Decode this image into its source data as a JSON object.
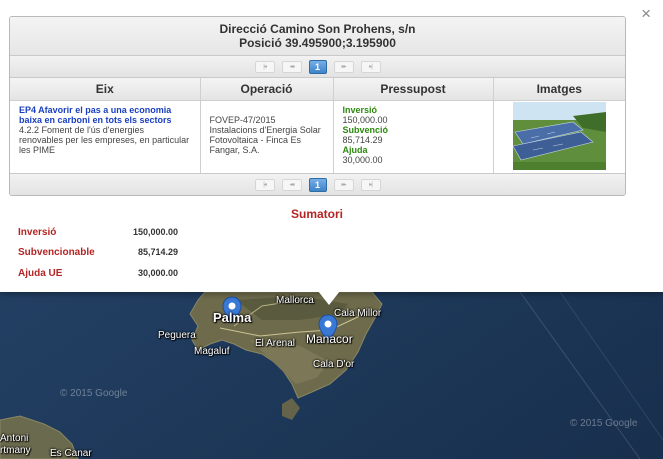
{
  "popup": {
    "close_symbol": "×",
    "header_line1": "Direcció Camino Son Prohens, s/n",
    "header_line2": "Posició 39.495900;3.195900",
    "pager": {
      "first": "|◂",
      "prev": "◂◂",
      "page": "1",
      "next": "▸▸",
      "last": "▸|"
    },
    "columns": [
      "Eix",
      "Operació",
      "Pressupost",
      "Imatges"
    ],
    "row": {
      "eix_title": "EP4 Afavorir el pas a una economia baixa en carboni en tots els sectors",
      "eix_desc": "4.2.2 Foment de l'ús d'energies renovables per les empreses, en particular les PIME",
      "operacio": "FOVEP-47/2015 Instalacions d'Energia Solar Fotovoltaica - Finca Es Fangar, S.A.",
      "inversio_label": "Inversió",
      "inversio_value": "150,000.00",
      "subvencio_label": "Subvenció",
      "subvencio_value": "85,714.29",
      "ajuda_label": "Ajuda",
      "ajuda_value": "30,000.00",
      "image_icon": "solar-panels-photo"
    },
    "summary": {
      "title": "Sumatori",
      "rows": [
        {
          "label": "Inversió",
          "value": "150,000.00"
        },
        {
          "label": "Subvencionable",
          "value": "85,714.29"
        },
        {
          "label": "Ajuda UE",
          "value": "30,000.00"
        }
      ]
    }
  },
  "map": {
    "labels": {
      "palma": "Palma",
      "mallorca": "Mallorca",
      "cala_millor": "Cala Millor",
      "peguera": "Peguera",
      "magaluf": "Magaluf",
      "el_arenal": "El Arenal",
      "manacor": "Manacor",
      "cala_dor": "Cala D'or",
      "antoni": "Antoni",
      "rtmany": "rtmany",
      "es_canar": "Es Canar",
      "copyright_google_left": "© 2015 Google",
      "copyright_google_right": "© 2015 Google"
    },
    "colors": {
      "sea": "#1d3a5c",
      "land": "#6b6a4e",
      "marker": "#3a78d6"
    }
  }
}
